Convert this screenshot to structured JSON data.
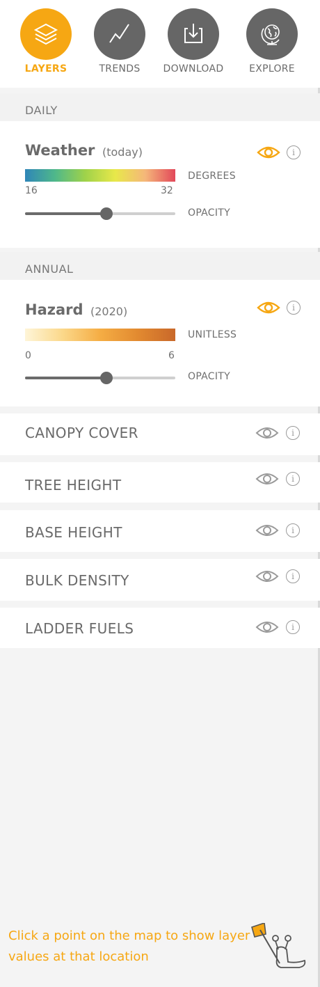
{
  "nav": {
    "items": [
      {
        "label": "LAYERS",
        "icon": "layers-icon",
        "active": true
      },
      {
        "label": "TRENDS",
        "icon": "trend-line-icon",
        "active": false
      },
      {
        "label": "DOWNLOAD",
        "icon": "download-icon",
        "active": false
      },
      {
        "label": "EXPLORE",
        "icon": "globe-icon",
        "active": false
      }
    ]
  },
  "sections": {
    "daily": "DAILY",
    "annual": "ANNUAL"
  },
  "weather": {
    "title": "Weather",
    "subtitle": "(today)",
    "unit": "DEGREES",
    "min": "16",
    "max": "32",
    "opacity_label": "OPACITY",
    "opacity_value": 0.54,
    "visible": true
  },
  "hazard": {
    "title": "Hazard",
    "subtitle": "(2020)",
    "unit": "UNITLESS",
    "min": "0",
    "max": "6",
    "opacity_label": "OPACITY",
    "opacity_value": 0.54,
    "visible": true
  },
  "layers": [
    {
      "label": "CANOPY COVER",
      "visible": false
    },
    {
      "label": "TREE HEIGHT",
      "visible": false
    },
    {
      "label": "BASE HEIGHT",
      "visible": false
    },
    {
      "label": "BULK DENSITY",
      "visible": false
    },
    {
      "label": "LADDER FUELS",
      "visible": false
    }
  ],
  "hint": {
    "text": "Click a point on the map to show layer values at that location",
    "icon": "flag-snail-icon"
  },
  "colors": {
    "accent": "#f6a713",
    "icon_gray": "#666666"
  }
}
